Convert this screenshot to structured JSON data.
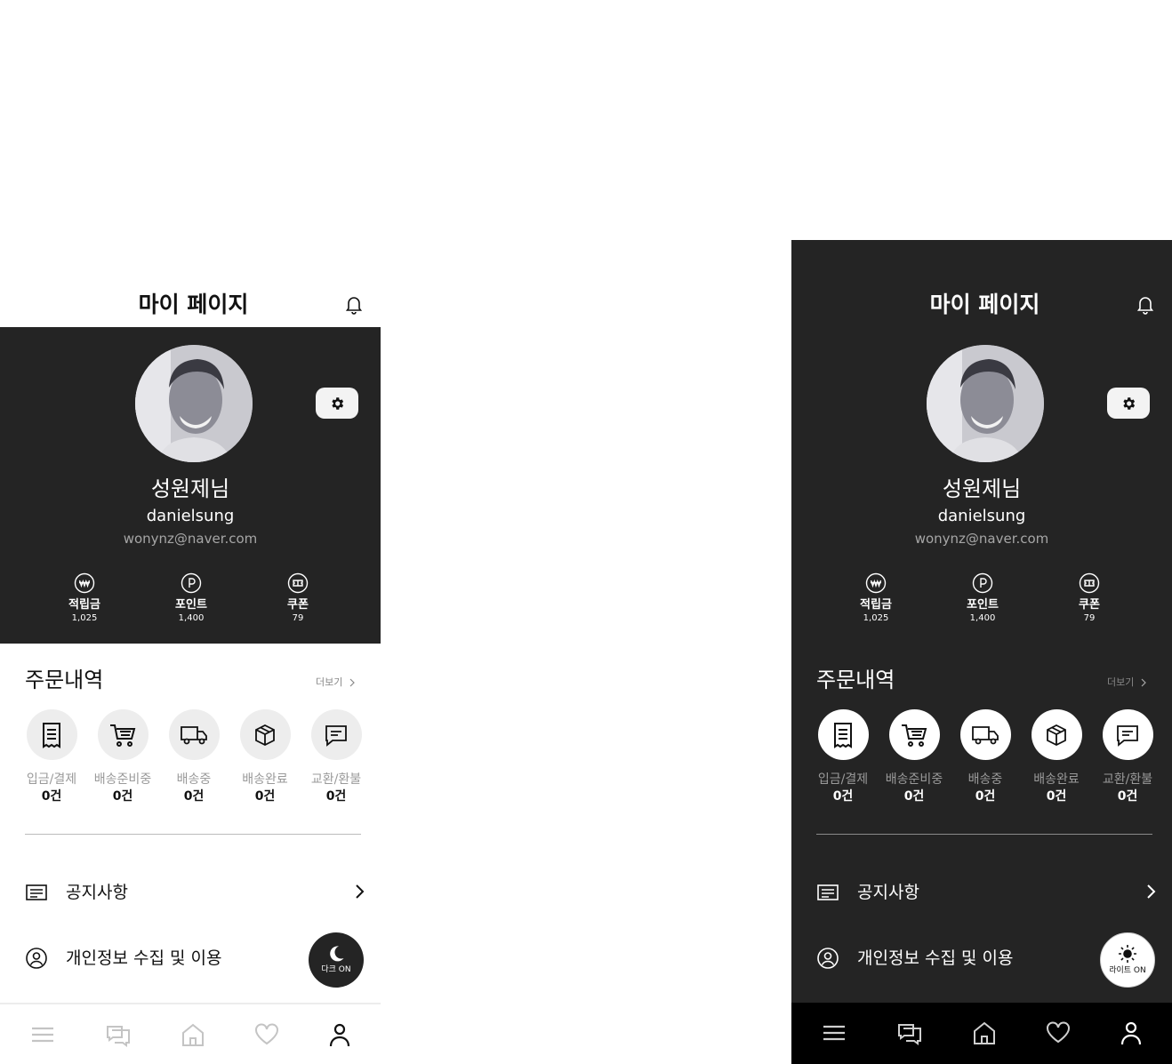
{
  "header": {
    "title": "마이 페이지"
  },
  "profile": {
    "name": "성원제님",
    "username": "danielsung",
    "email": "wonynz@naver.com"
  },
  "stats": [
    {
      "label": "적립금",
      "value": "1,025",
      "icon": "won-coin-icon"
    },
    {
      "label": "포인트",
      "value": "1,400",
      "icon": "point-coin-icon"
    },
    {
      "label": "쿠폰",
      "value": "79",
      "icon": "coupon-icon"
    }
  ],
  "orders": {
    "title": "주문내역",
    "more_label": "더보기",
    "steps": [
      {
        "label": "입금/결제",
        "count": "0건",
        "icon": "receipt-icon"
      },
      {
        "label": "배송준비중",
        "count": "0건",
        "icon": "cart-icon"
      },
      {
        "label": "배송중",
        "count": "0건",
        "icon": "truck-icon"
      },
      {
        "label": "배송완료",
        "count": "0건",
        "icon": "box-icon"
      },
      {
        "label": "교환/환불",
        "count": "0건",
        "icon": "chat-icon"
      }
    ]
  },
  "menu": [
    {
      "label": "공지사항",
      "icon": "notice-icon"
    },
    {
      "label": "개인정보 수집 및 이용",
      "icon": "user-circle-icon"
    }
  ],
  "theme_toggle": {
    "light_page_label": "다크 ON",
    "dark_page_label": "라이트 ON"
  },
  "tabs": [
    "menu-icon",
    "chat-bubble-icon",
    "home-icon",
    "heart-icon",
    "user-icon"
  ],
  "colors": {
    "dark_bg": "#242424",
    "tab_active": "#111111",
    "tab_inactive": "#c4c4c4"
  }
}
